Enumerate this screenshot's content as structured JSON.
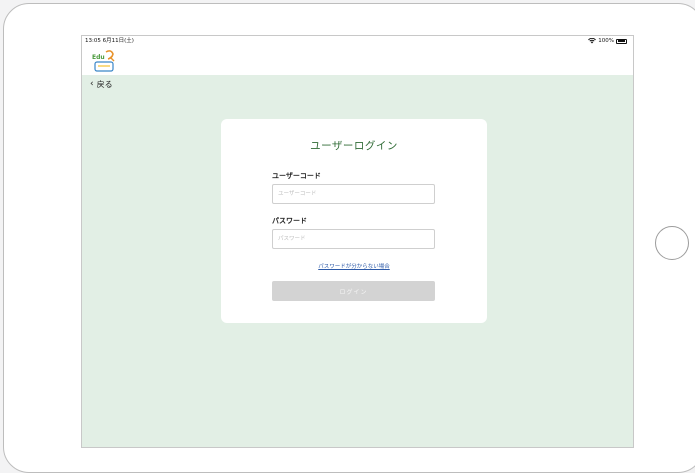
{
  "status_bar": {
    "time_date": "13:05  6月11日(土)",
    "battery_text": "100%"
  },
  "app": {
    "logo_icon": "eduq-logo-icon",
    "logo_text": "Edu"
  },
  "nav": {
    "back_label": "戻る",
    "back_icon": "chevron-left-icon"
  },
  "login": {
    "title": "ユーザーログイン",
    "user_code_label": "ユーザーコード",
    "user_code_placeholder": "ユーザーコード",
    "user_code_value": "",
    "password_label": "パスワード",
    "password_placeholder": "パスワード",
    "password_value": "",
    "forgot_link": "パスワードが分からない場合",
    "submit_label": "ログイン"
  },
  "colors": {
    "content_bg": "#e2efe5",
    "title_green": "#2f6b35",
    "link_blue": "#2d5aa8",
    "button_disabled": "#d3d3d3"
  }
}
